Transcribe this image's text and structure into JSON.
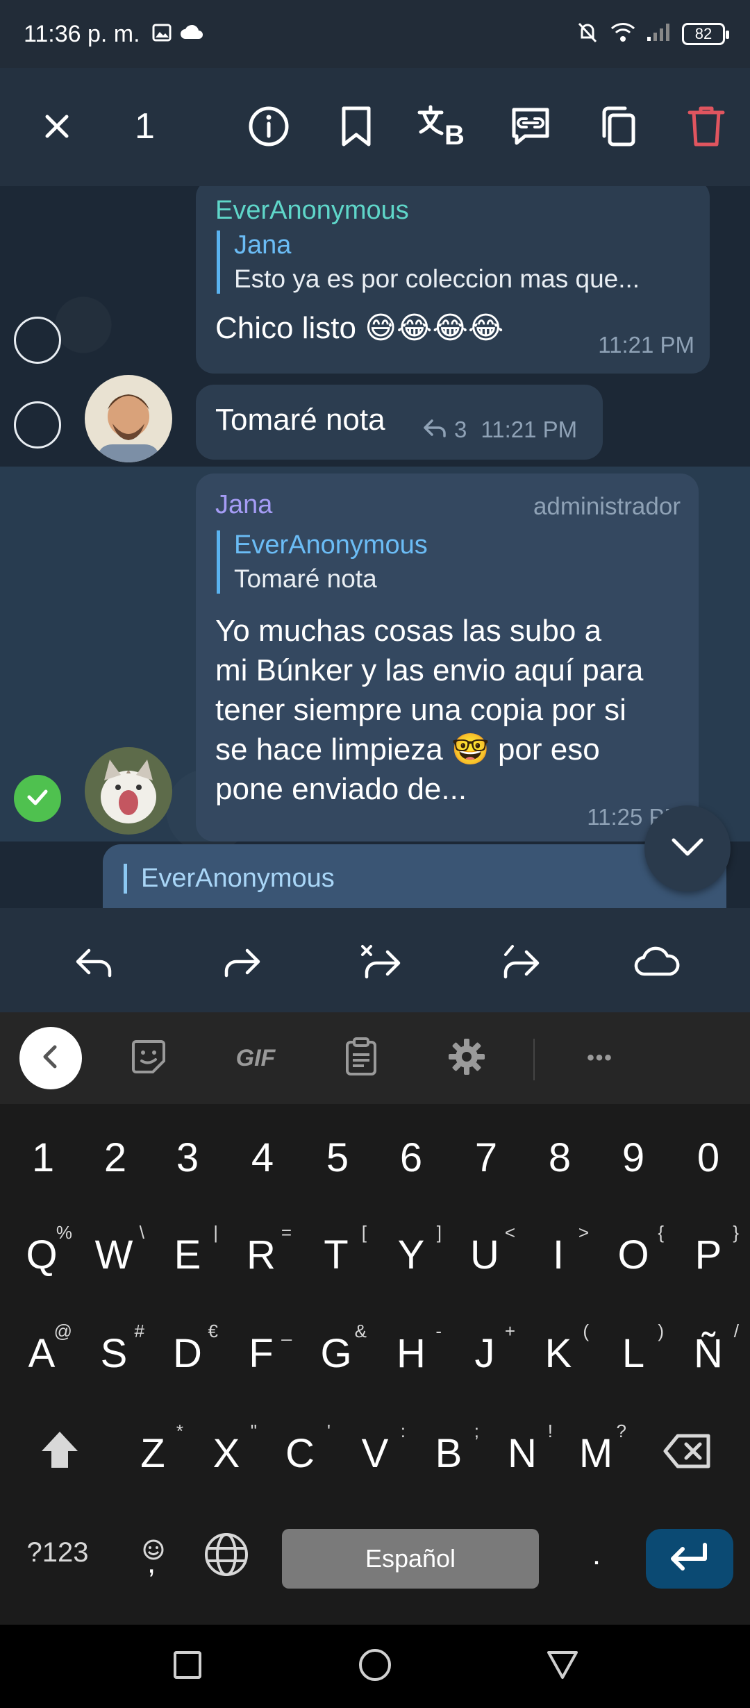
{
  "status_bar": {
    "time": "11:36 p. m.",
    "battery": "82"
  },
  "action_bar": {
    "selected_count": "1"
  },
  "messages": [
    {
      "sender": "EverAnonymous",
      "reply_name": "Jana",
      "reply_text": "Esto ya es por coleccion mas que...",
      "text": "Chico listo 😅😂😂😂",
      "time": "11:21 PM"
    },
    {
      "text": "Tomaré nota",
      "replies_count": "3",
      "time": "11:21 PM"
    },
    {
      "sender": "Jana",
      "role": "administrador",
      "reply_name": "EverAnonymous",
      "reply_text": "Tomaré nota",
      "text_lines": [
        "Yo muchas cosas las subo a",
        "mi Búnker y las envio aquí para",
        "tener siempre una copia por si",
        "se hace limpieza 🤓 por eso",
        "pone enviado de..."
      ],
      "time": "11:25 PM"
    },
    {
      "reply_name": "EverAnonymous"
    }
  ],
  "keyboard": {
    "toolbar": {
      "gif": "GIF",
      "more": "•••"
    },
    "number_row": [
      "1",
      "2",
      "3",
      "4",
      "5",
      "6",
      "7",
      "8",
      "9",
      "0"
    ],
    "row1": [
      [
        "Q",
        "%"
      ],
      [
        "W",
        "\\"
      ],
      [
        "E",
        "|"
      ],
      [
        "R",
        "="
      ],
      [
        "T",
        "["
      ],
      [
        "Y",
        "]"
      ],
      [
        "U",
        "<"
      ],
      [
        "I",
        ">"
      ],
      [
        "O",
        "{"
      ],
      [
        "P",
        "}"
      ]
    ],
    "row2": [
      [
        "A",
        "@"
      ],
      [
        "S",
        "#"
      ],
      [
        "D",
        "€"
      ],
      [
        "F",
        "_"
      ],
      [
        "G",
        "&"
      ],
      [
        "H",
        "-"
      ],
      [
        "J",
        "+"
      ],
      [
        "K",
        "("
      ],
      [
        "L",
        ")"
      ],
      [
        "Ñ",
        "/"
      ]
    ],
    "row3": [
      [
        "Z",
        "*"
      ],
      [
        "X",
        "\""
      ],
      [
        "C",
        "'"
      ],
      [
        "V",
        ":"
      ],
      [
        "B",
        ";"
      ],
      [
        "N",
        "!"
      ],
      [
        "M",
        "?"
      ]
    ],
    "symbols_key": "?123",
    "comma_key": ",",
    "space_label": "Español",
    "period_key": "."
  },
  "colors": {
    "sender_teal": "#5fd6c9",
    "sender_purple": "#a59cf5",
    "link_blue": "#6bbcf5",
    "delete_red": "#e0555f",
    "check_green": "#4fc14f"
  }
}
